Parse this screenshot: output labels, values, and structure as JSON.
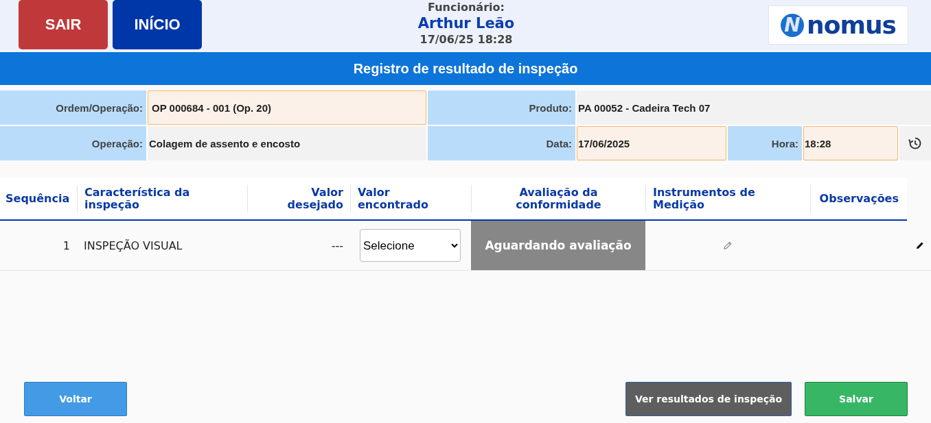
{
  "header": {
    "buttons": [
      {
        "label": "SAIR",
        "kind": "exit"
      },
      {
        "label": "INÍCIO",
        "kind": "home"
      }
    ],
    "employee_label": "Funcionário:",
    "employee_name": "Arthur Leão",
    "datetime": "17/06/25 18:28",
    "logo": {
      "mark": "N",
      "text": "nomus"
    }
  },
  "title": "Registro de resultado de inspeção",
  "form": {
    "rows": [
      {
        "fields": [
          {
            "label": "Ordem/Operação:",
            "value": "OP 000684 - 001 (Op. 20)",
            "kind": "input"
          },
          {
            "label": "Produto:",
            "value": "PA 00052 - Cadeira Tech 07",
            "kind": "readonly"
          }
        ]
      },
      {
        "fields": [
          {
            "label": "Operação:",
            "value": "Colagem de assento e encosto",
            "kind": "readonly"
          },
          {
            "label": "Data:",
            "value": "17/06/2025",
            "kind": "input"
          },
          {
            "label": "Hora:",
            "value": "18:28",
            "kind": "input"
          }
        ]
      }
    ]
  },
  "table": {
    "columns": [
      "Sequência",
      "Característica da inspeção",
      "Valor desejado",
      "Valor encontrado",
      "Avaliação da conformidade",
      "Instrumentos de Medição",
      "Observações"
    ],
    "rows": [
      {
        "sequence": "1",
        "characteristic": "INSPEÇÃO VISUAL",
        "desired": "---",
        "found": "Selecione",
        "evaluation": {
          "text": "Aguardando avaliação",
          "kind": "pending"
        }
      }
    ]
  },
  "footer": {
    "buttons": [
      {
        "label": "Voltar",
        "kind": "back"
      },
      {
        "label": "Ver resultados de inspeção",
        "kind": "results"
      },
      {
        "label": "Salvar",
        "kind": "save"
      }
    ]
  }
}
